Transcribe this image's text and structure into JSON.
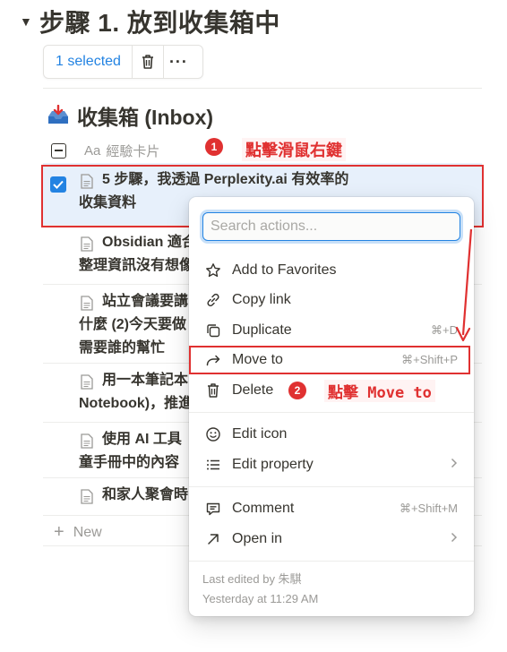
{
  "heading": {
    "toggle": "▼",
    "title": "步驟 1. 放到收集箱中"
  },
  "selection_bar": {
    "count_label": "1 selected"
  },
  "database": {
    "title": "收集箱 (Inbox)",
    "title_icon": "inbox-tray-icon",
    "column_prefix": "Aa",
    "column_name": "經驗卡片"
  },
  "annotations": {
    "step1_badge": "1",
    "step1_text": "點擊滑鼠右鍵",
    "step2_badge": "2",
    "step2_text": "點擊 Move to",
    "accent_color": "#e03131"
  },
  "rows": [
    {
      "text": "5 步驟，我透過 Perplexity.ai 有效率的收集資料",
      "selected": true
    },
    {
      "text": "Obsidian 適合整理資訊沒有想像的",
      "selected": false
    },
    {
      "text": "站立會議要講什麼 (2)今天要做需要誰的幫忙",
      "selected": false
    },
    {
      "text": "用一本筆記本Notebook)，推進",
      "selected": false
    },
    {
      "text": "使用 AI 工具童手冊中的內容",
      "selected": false
    },
    {
      "text": "和家人聚會時",
      "selected": false
    }
  ],
  "row_lines": [
    [
      "5 步驟，我透過 Perplexity.ai 有效率的",
      "收集資料"
    ],
    [
      "Obsidian 適合",
      "整理資訊沒有想像"
    ],
    [
      "站立會議要講",
      "什麼 (2)今天要做",
      "需要誰的幫忙"
    ],
    [
      "用一本筆記本",
      "Notebook)，推進"
    ],
    [
      "使用 AI 工具",
      "童手冊中的內容"
    ],
    [
      "和家人聚會時"
    ]
  ],
  "new_label": "New",
  "menu": {
    "search_placeholder": "Search actions...",
    "items": [
      {
        "label": "Add to Favorites",
        "icon": "star-icon",
        "shortcut": ""
      },
      {
        "label": "Copy link",
        "icon": "link-icon",
        "shortcut": ""
      },
      {
        "label": "Duplicate",
        "icon": "duplicate-icon",
        "shortcut": "⌘+D"
      },
      {
        "label": "Move to",
        "icon": "move-arrow-icon",
        "shortcut": "⌘+Shift+P"
      },
      {
        "label": "Delete",
        "icon": "trash-icon",
        "shortcut": ""
      },
      {
        "label": "Edit icon",
        "icon": "smiley-icon",
        "shortcut": ""
      },
      {
        "label": "Edit property",
        "icon": "list-icon",
        "shortcut": ""
      },
      {
        "label": "Comment",
        "icon": "comment-icon",
        "shortcut": "⌘+Shift+M"
      },
      {
        "label": "Open in",
        "icon": "open-arrow-icon",
        "shortcut": ""
      }
    ],
    "footer_line1": "Last edited by 朱騏",
    "footer_line2": "Yesterday at 11:29 AM"
  },
  "colors": {
    "accent_blue": "#2383e2",
    "text": "#37352f",
    "muted": "#9b9a97",
    "selected_row_bg": "#e7f0fb"
  }
}
